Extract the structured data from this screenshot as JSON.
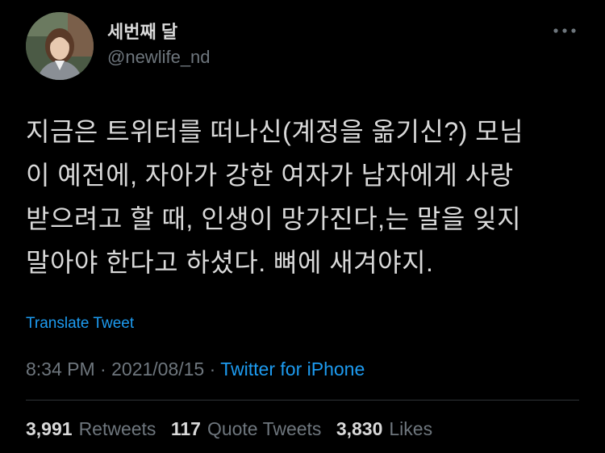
{
  "author": {
    "display_name": "세번째 달",
    "handle": "@newlife_nd"
  },
  "tweet": {
    "text": "지금은 트위터를 떠나신(계정을 옮기신?) 모님\n이 예전에, 자아가 강한 여자가 남자에게 사랑\n받으려고 할 때, 인생이 망가진다,는 말을 잊지\n말아야 한다고 하셨다. 뼈에 새겨야지.",
    "translate_label": "Translate Tweet",
    "time": "8:34 PM",
    "separator": " · ",
    "date": "2021/08/15",
    "source": "Twitter for iPhone"
  },
  "stats": {
    "retweets_count": "3,991",
    "retweets_label": "Retweets",
    "quotes_count": "117",
    "quotes_label": "Quote Tweets",
    "likes_count": "3,830",
    "likes_label": "Likes"
  },
  "icons": {
    "more": "more-horizontal-icon"
  },
  "colors": {
    "background": "#000000",
    "text": "#d9d9d9",
    "secondary": "#6e767d",
    "link": "#1d9bf0",
    "divider": "#2f3336"
  }
}
